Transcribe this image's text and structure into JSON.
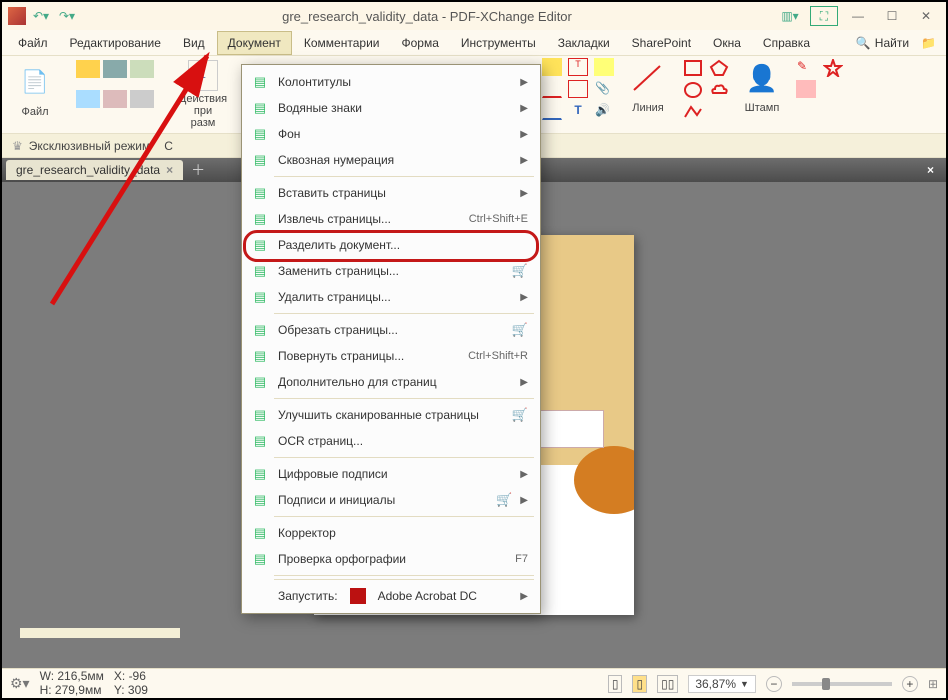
{
  "title": "gre_research_validity_data - PDF-XChange Editor",
  "menubar": [
    "Файл",
    "Редактирование",
    "Вид",
    "Документ",
    "Комментарии",
    "Форма",
    "Инструменты",
    "Закладки",
    "SharePoint",
    "Окна",
    "Справка"
  ],
  "find_label": "Найти",
  "ribbon": {
    "file": "Файл",
    "actions": "Действия при\nразм",
    "tools": {
      "line": "Линия",
      "stamp": "Штамп"
    }
  },
  "mode_bar": {
    "label": "Эксклюзивный режим",
    "short": "С"
  },
  "tab": {
    "name": "gre_research_validity_data"
  },
  "dropdown": {
    "items": [
      {
        "label": "Колонтитулы",
        "arrow": true
      },
      {
        "label": "Водяные знаки",
        "arrow": true
      },
      {
        "label": "Фон",
        "arrow": true
      },
      {
        "label": "Сквозная нумерация",
        "arrow": true,
        "sep": true
      },
      {
        "label": "Вставить страницы",
        "arrow": true
      },
      {
        "label": "Извлечь страницы...",
        "shortcut": "Ctrl+Shift+E"
      },
      {
        "label": "Разделить документ..."
      },
      {
        "label": "Заменить страницы...",
        "cart": true
      },
      {
        "label": "Удалить страницы...",
        "arrow": true,
        "sep": true
      },
      {
        "label": "Обрезать страницы...",
        "cart": true
      },
      {
        "label": "Повернуть страницы...",
        "shortcut": "Ctrl+Shift+R"
      },
      {
        "label": "Дополнительно для страниц",
        "arrow": true,
        "sep": true
      },
      {
        "label": "Улучшить сканированные страницы",
        "cart": true
      },
      {
        "label": "OCR страниц...",
        "sep": true
      },
      {
        "label": "Цифровые подписи",
        "arrow": true
      },
      {
        "label": "Подписи и инициалы",
        "arrow": true,
        "cart": true,
        "sep": true
      },
      {
        "label": "Корректор"
      },
      {
        "label": "Проверка орфографии",
        "shortcut": "F7",
        "sep": true
      }
    ],
    "launch_label": "Запустить:",
    "launch_app": "Adobe Acrobat DC"
  },
  "status": {
    "w": "W: 216,5мм",
    "h": "H: 279,9мм",
    "x": "X: -96",
    "y": "Y: 309",
    "zoom": "36,87%"
  }
}
